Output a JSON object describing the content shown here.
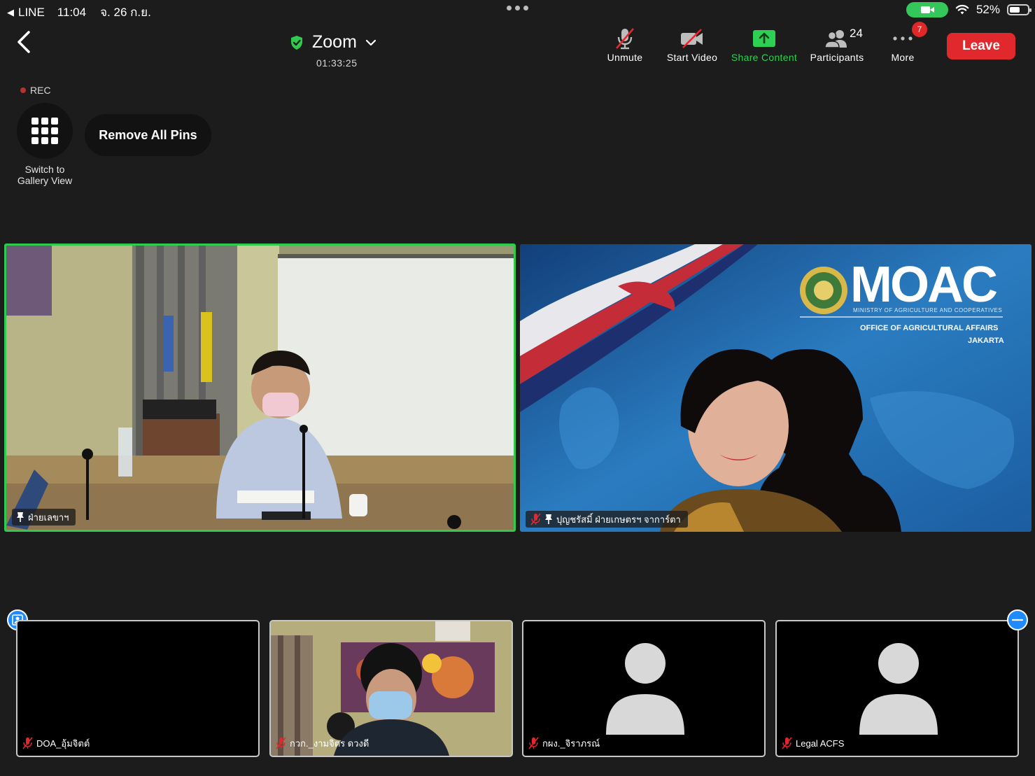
{
  "status_bar": {
    "back_app": "LINE",
    "time": "11:04",
    "date": "จ. 26 ก.ย.",
    "battery": "52%",
    "battery_level": 0.52
  },
  "meeting": {
    "title": "Zoom",
    "timer": "01:33:25",
    "recording_label": "REC"
  },
  "toolbar": {
    "unmute": "Unmute",
    "start_video": "Start Video",
    "share_content": "Share Content",
    "participants": "Participants",
    "participants_count": "24",
    "more": "More",
    "more_badge": "7",
    "leave": "Leave"
  },
  "view_controls": {
    "gallery_label_line1": "Switch to",
    "gallery_label_line2": "Gallery View",
    "remove_pins": "Remove All Pins"
  },
  "main_tiles": [
    {
      "name": "ฝ่ายเลขาฯ",
      "muted": false,
      "pinned": true,
      "active_speaker": true
    },
    {
      "name": "ปุญชรัสมิ์ ฝ่ายเกษตรฯ จาการ์ตา",
      "muted": true,
      "pinned": true,
      "active_speaker": false
    }
  ],
  "moac_banner": {
    "logo_text": "MOAC",
    "ministry": "MINISTRY OF AGRICULTURE AND COOPERATIVES",
    "office": "OFFICE OF AGRICULTURAL AFFAIRS",
    "city": "JAKARTA"
  },
  "thumbnails": [
    {
      "name": "DOA_อุ้มจิตต์",
      "muted": true,
      "video": false
    },
    {
      "name": "กวก._งามจิตร ดวงดี",
      "muted": true,
      "video": true
    },
    {
      "name": "กผง._จิราภรณ์",
      "muted": true,
      "video": false
    },
    {
      "name": "Legal ACFS",
      "muted": true,
      "video": false
    }
  ],
  "colors": {
    "accent_green": "#2fcb4f",
    "leave_red": "#e1282c",
    "badge_blue": "#1f8bff"
  }
}
